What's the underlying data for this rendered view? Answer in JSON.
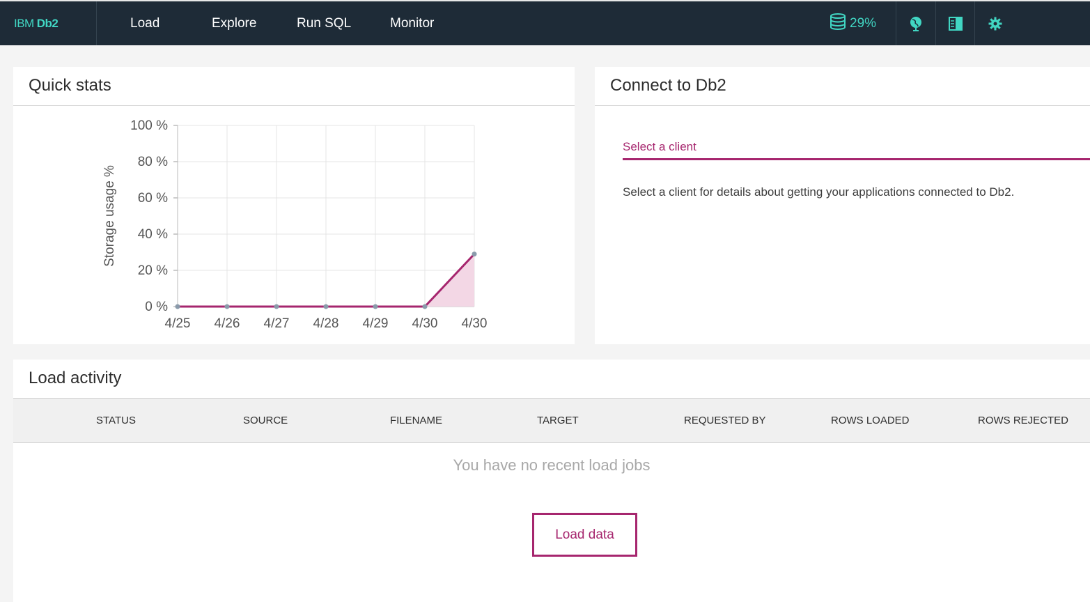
{
  "brand": {
    "prefix": "IBM",
    "name": "Db2"
  },
  "nav": {
    "items": [
      "Load",
      "Explore",
      "Run SQL",
      "Monitor"
    ]
  },
  "storage": {
    "value": "29%",
    "icon": "database-icon"
  },
  "header_icons": [
    "globe-icon",
    "book-icon",
    "gear-icon"
  ],
  "colors": {
    "accent": "#41d6c3",
    "brand_magenta": "#a6266e",
    "nav_bg": "#1e2b37"
  },
  "quick_stats": {
    "title": "Quick stats"
  },
  "chart_data": {
    "type": "area",
    "ylabel": "Storage usage %",
    "xlabel": "",
    "categories": [
      "4/25",
      "4/26",
      "4/27",
      "4/28",
      "4/29",
      "4/30",
      "4/30"
    ],
    "values": [
      0,
      0,
      0,
      0,
      0,
      0,
      29
    ],
    "y_ticks": [
      "100 %",
      "80 %",
      "60 %",
      "40 %",
      "20 %",
      "0 %"
    ],
    "ylim": [
      0,
      100
    ],
    "grid": true
  },
  "connect": {
    "title": "Connect to Db2",
    "tab_label": "Select a client",
    "description": "Select a client for details about getting your applications connected to Db2."
  },
  "load_activity": {
    "title": "Load activity",
    "columns": [
      "STATUS",
      "SOURCE",
      "FILENAME",
      "TARGET",
      "REQUESTED BY",
      "ROWS LOADED",
      "ROWS REJECTED"
    ],
    "empty_message": "You have no recent load jobs",
    "button_label": "Load data"
  }
}
